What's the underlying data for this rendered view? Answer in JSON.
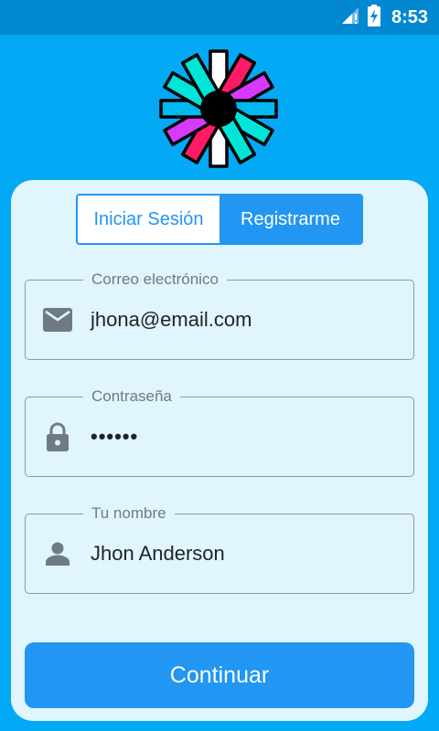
{
  "status_bar": {
    "time": "8:53",
    "icons": [
      "signal-icon",
      "battery-charging-icon"
    ]
  },
  "logo": {
    "name": "colorful-asterisk-logo"
  },
  "auth_toggle": {
    "login_label": "Iniciar Sesión",
    "register_label": "Registrarme",
    "selected": "register"
  },
  "form": {
    "email": {
      "label": "Correo electrónico",
      "value": "jhona@email.com",
      "icon": "email-icon"
    },
    "password": {
      "label": "Contraseña",
      "value": "••••••",
      "icon": "lock-icon"
    },
    "name": {
      "label": "Tu nombre",
      "value": "Jhon Anderson",
      "icon": "person-icon"
    }
  },
  "submit_label": "Continuar",
  "colors": {
    "background": "#03A9F4",
    "status_bar": "#0288D1",
    "card": "#E1F5FE",
    "accent": "#2196F3"
  }
}
